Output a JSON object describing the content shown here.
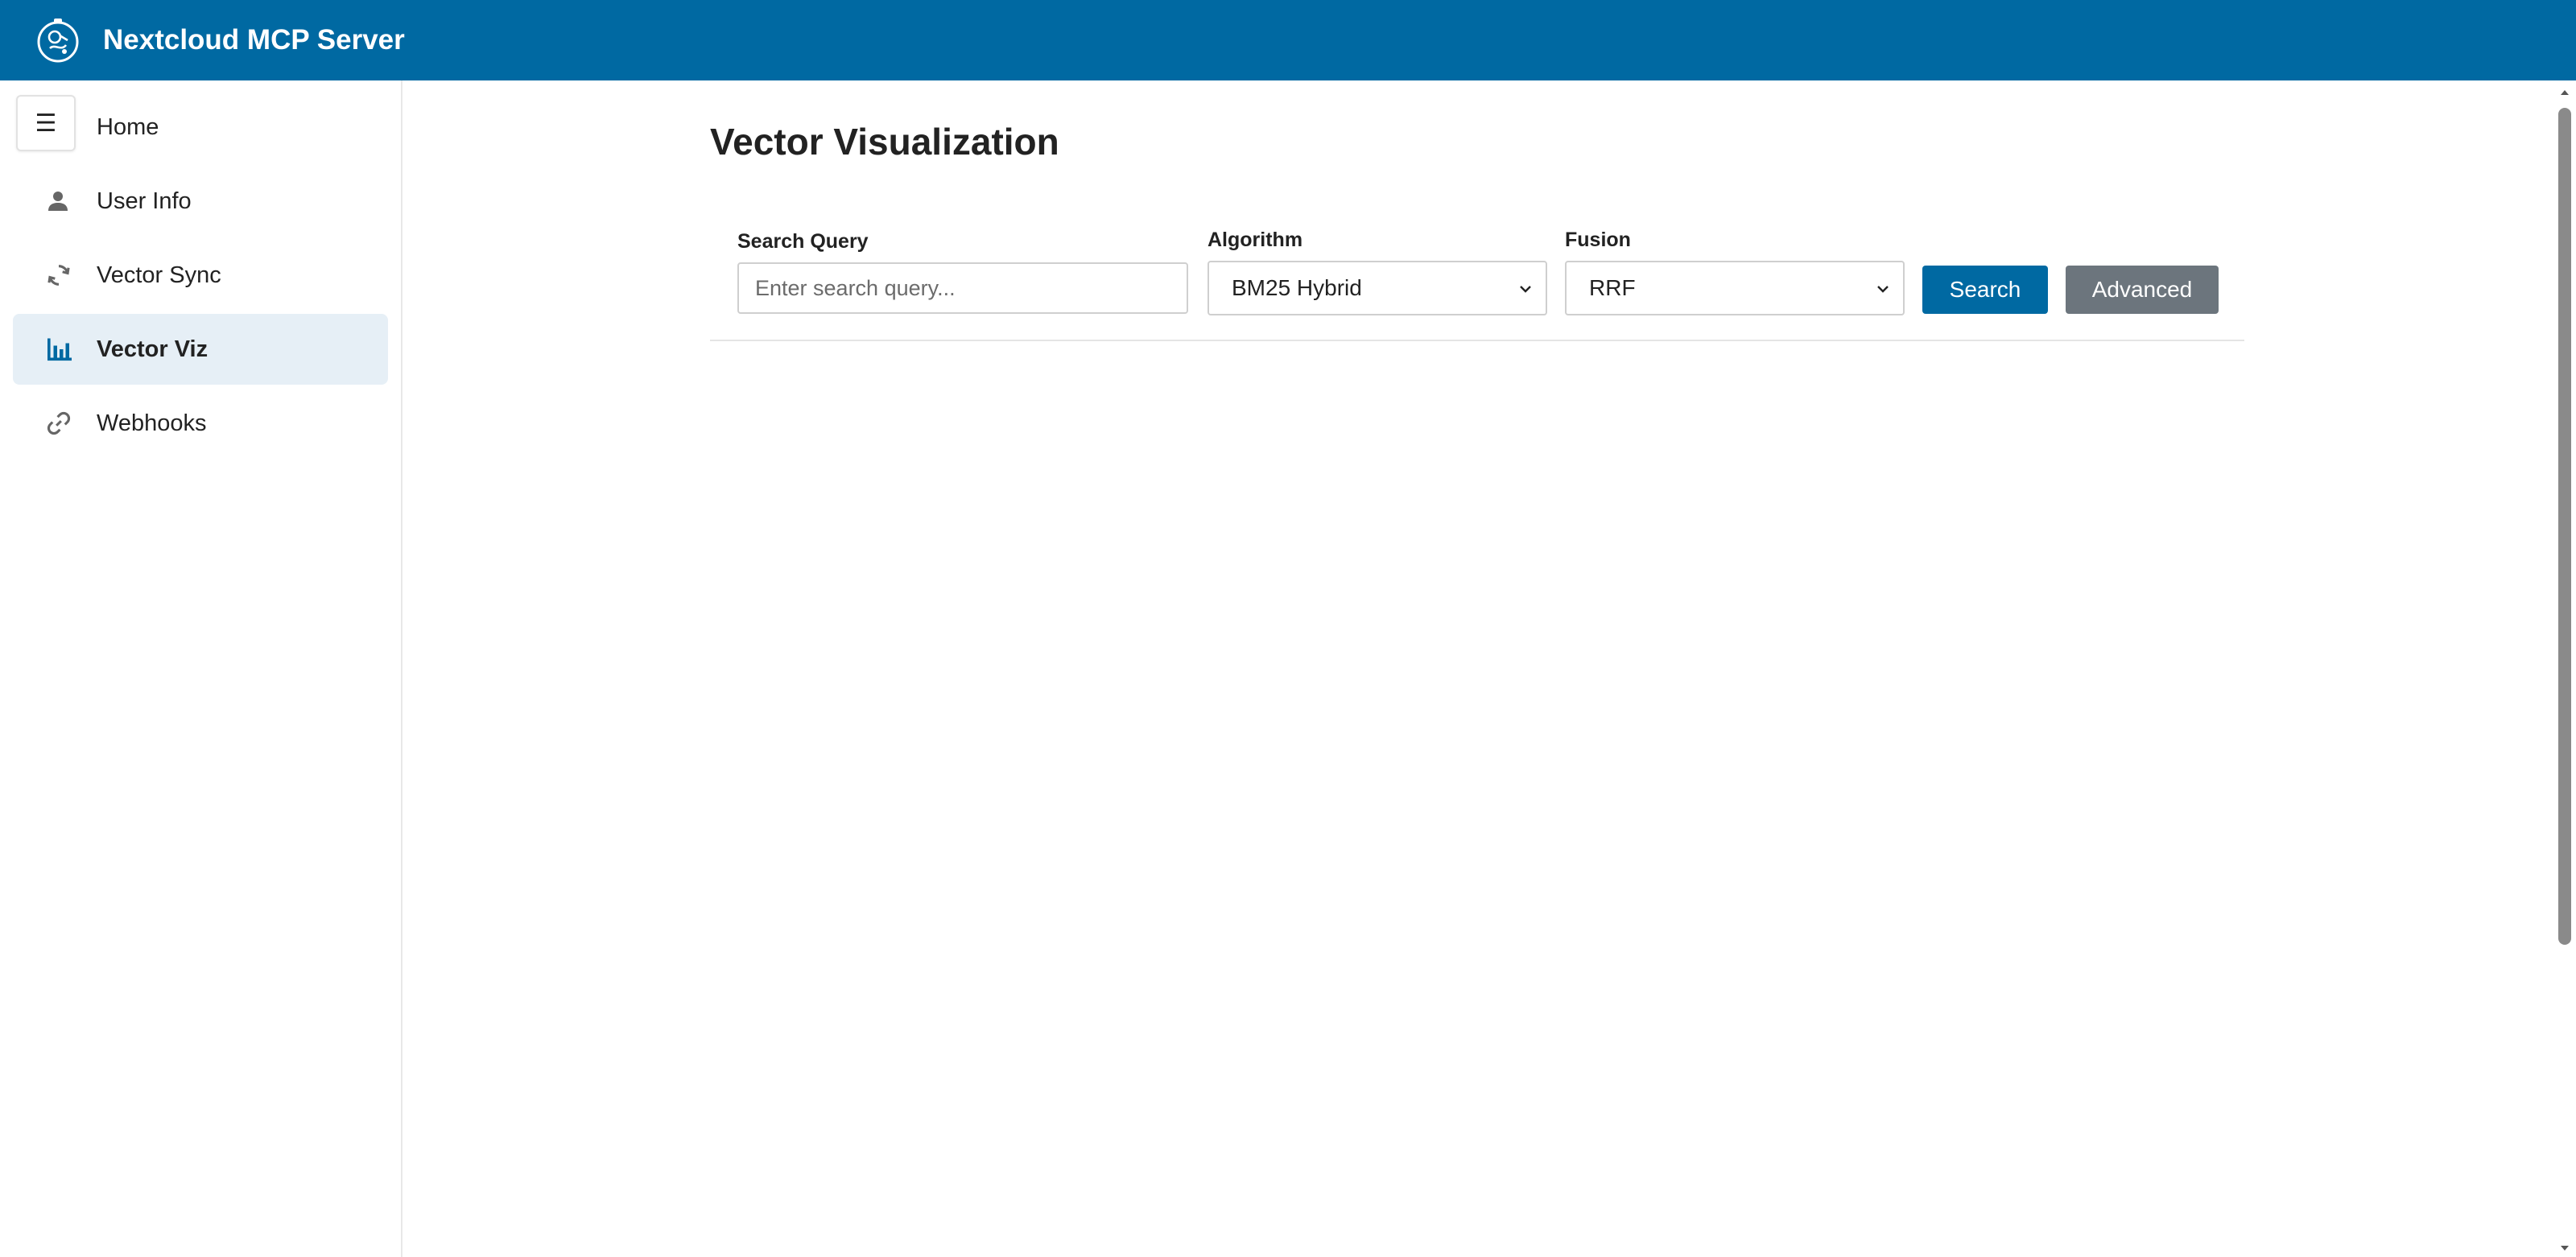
{
  "app": {
    "title": "Nextcloud MCP Server"
  },
  "sidebar": {
    "toggle_glyph": "☰",
    "items": [
      {
        "label": "Home",
        "icon": "home-icon",
        "active": false
      },
      {
        "label": "User Info",
        "icon": "user-icon",
        "active": false
      },
      {
        "label": "Vector Sync",
        "icon": "sync-icon",
        "active": false
      },
      {
        "label": "Vector Viz",
        "icon": "bar-chart-icon",
        "active": true
      },
      {
        "label": "Webhooks",
        "icon": "link-icon",
        "active": false
      }
    ]
  },
  "main": {
    "title": "Vector Visualization",
    "search": {
      "label": "Search Query",
      "placeholder": "Enter search query...",
      "value": ""
    },
    "algorithm": {
      "label": "Algorithm",
      "selected": "BM25 Hybrid"
    },
    "fusion": {
      "label": "Fusion",
      "selected": "RRF"
    },
    "buttons": {
      "search": "Search",
      "advanced": "Advanced"
    }
  },
  "colors": {
    "header": "#0069a2",
    "primary_button": "#0069a2",
    "secondary_button": "#6c757d",
    "active_nav_bg": "#e6eff6",
    "active_icon": "#0069a2"
  }
}
